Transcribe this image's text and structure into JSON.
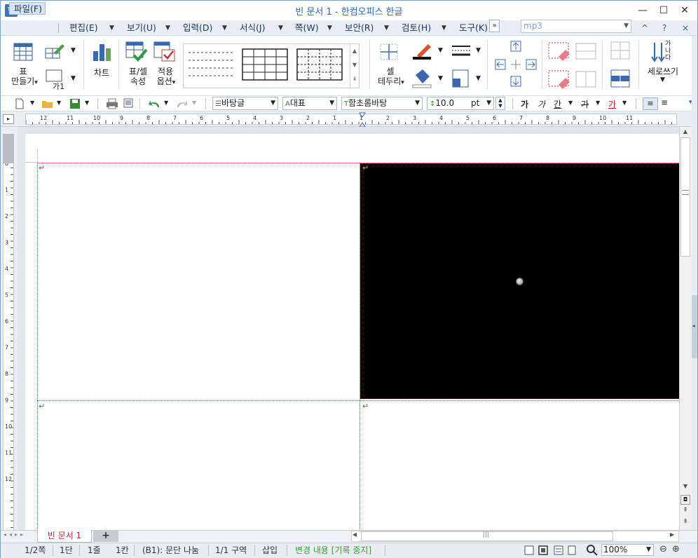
{
  "window": {
    "title": "빈 문서 1 - 한컴오피스 한글",
    "logo": "한",
    "controls": {
      "minimize": "—",
      "maximize": "☐",
      "close": "✕"
    }
  },
  "menu": {
    "items": [
      "파일(F)",
      "편집(E)",
      "보기(U)",
      "입력(D)",
      "서식(J)",
      "쪽(W)",
      "보안(R)",
      "검토(H)",
      "도구(K)"
    ],
    "expand": "»",
    "search_value": "mp3",
    "right_controls": [
      "^",
      "?",
      "×"
    ]
  },
  "ribbon": {
    "table_make_line1": "표",
    "table_make_line2": "만들기",
    "ga1_label": "가1",
    "chart_label": "차트",
    "table_props_line1": "표/셀",
    "table_props_line2": "속성",
    "apply_opts_line1": "적용",
    "apply_opts_line2": "옵션",
    "cell_border_line1": "셀",
    "cell_border_line2": "테두리",
    "vertical_write": "세로쓰기",
    "vertical_glyphs": [
      "가",
      "나",
      "다"
    ]
  },
  "toolbar": {
    "style_value": "바탕글",
    "lang_value": "대표",
    "font_value": "함초롬바탕",
    "size_value": "10.0",
    "size_unit": "pt",
    "char_btns": [
      "가",
      "가",
      "간",
      "가",
      "가"
    ]
  },
  "ruler": {
    "h_labels": [
      "12",
      "11",
      "10",
      "9",
      "8",
      "7",
      "6",
      "5",
      "4",
      "3",
      "2",
      "1",
      "1",
      "2",
      "3",
      "4",
      "5",
      "6",
      "7",
      "8",
      "9",
      "10",
      "11"
    ],
    "v_labels": [
      "0",
      "1",
      "2",
      "3",
      "4",
      "5",
      "6",
      "7",
      "8",
      "9",
      "10",
      "11",
      "12"
    ]
  },
  "document": {
    "tab_label": "빈 문서 1",
    "add_tab": "+",
    "para_mark": "↵"
  },
  "status": {
    "page": "1/2쪽",
    "col": "1단",
    "line": "1줄",
    "char": "1칸",
    "cell": "(B1): 문단 나눔",
    "section": "1/1 구역",
    "mode": "삽입",
    "track": "변경 내용 [기록 중지]",
    "zoom": "100%"
  },
  "colors": {
    "title_blue": "#3366aa",
    "menu_bg": "#e9eef6",
    "tab_red": "#b0283c",
    "track_green": "#3a9a3a",
    "para_blue": "#3a67c6",
    "cell_dotted": "#e04848"
  }
}
